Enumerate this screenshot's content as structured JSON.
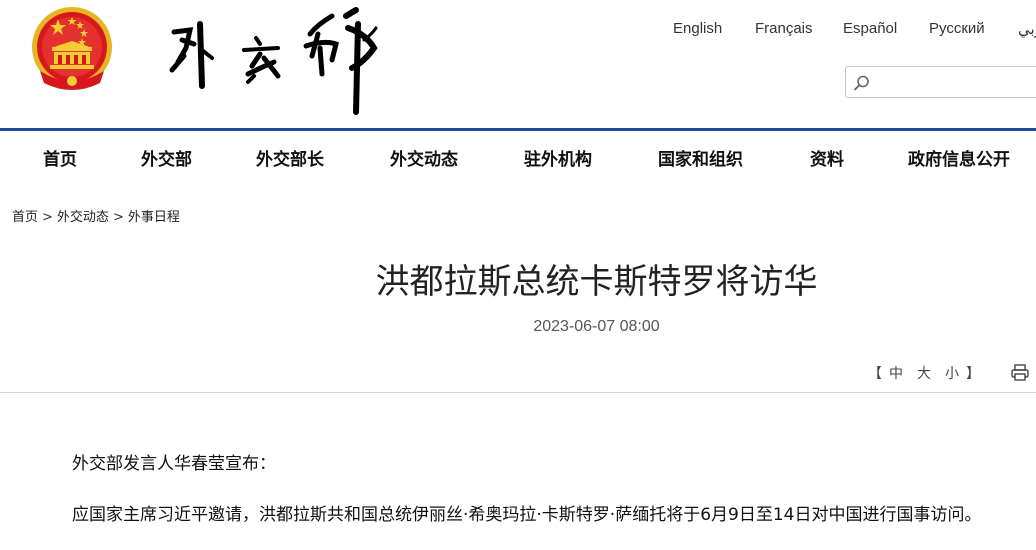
{
  "header": {
    "logo_text": "外交部",
    "languages": [
      "English",
      "Français",
      "Español",
      "Русский",
      "عربي"
    ],
    "search": {
      "placeholder": "",
      "value": ""
    }
  },
  "nav": {
    "items": [
      "首页",
      "外交部",
      "外交部长",
      "外交动态",
      "驻外机构",
      "国家和组织",
      "资料",
      "政府信息公开"
    ]
  },
  "breadcrumb": {
    "items": [
      "首页",
      "外交动态",
      "外事日程"
    ],
    "separator": ">"
  },
  "article": {
    "title": "洪都拉斯总统卡斯特罗将访华",
    "date": "2023-06-07 08:00",
    "font_controls": {
      "open": "【",
      "options": [
        "中",
        "大",
        "小"
      ],
      "close": "】"
    },
    "paragraphs": [
      "外交部发言人华春莹宣布：",
      "应国家主席习近平邀请，洪都拉斯共和国总统伊丽丝·希奥玛拉·卡斯特罗·萨缅托将于6月9日至14日对中国进行国事访问。"
    ]
  },
  "icons": {
    "emblem": "national-emblem-icon",
    "search": "search-icon",
    "print": "print-icon"
  },
  "colors": {
    "nav_line": "#1e4b9a",
    "emblem_red": "#d7161e",
    "emblem_gold": "#f2c42a"
  }
}
